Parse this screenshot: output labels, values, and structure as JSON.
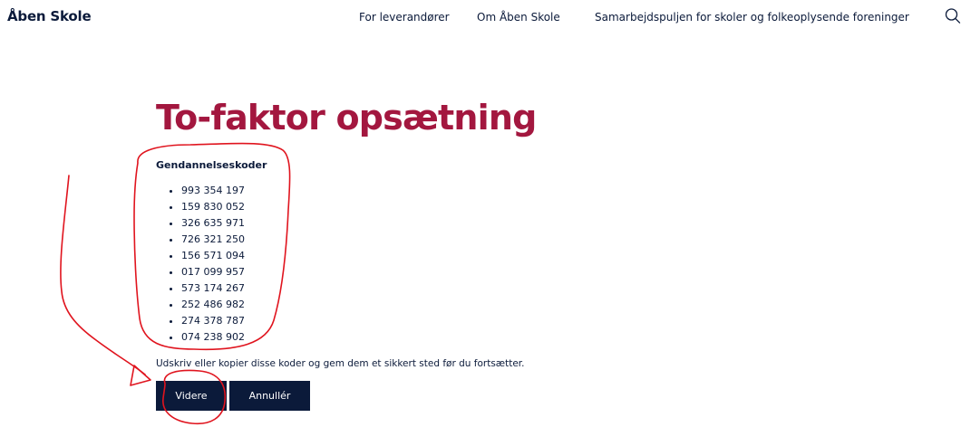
{
  "header": {
    "logo": "Åben Skole",
    "nav": [
      {
        "label": "For leverandører"
      },
      {
        "label": "Om Åben Skole"
      },
      {
        "label": "Samarbejdspuljen for skoler og folkeoplysende foreninger"
      }
    ],
    "search_icon": "search-icon"
  },
  "main": {
    "title": "To-faktor opsætning",
    "codes_heading": "Gendannelseskoder",
    "codes": [
      "993 354 197",
      "159 830 052",
      "326 635 971",
      "726 321 250",
      "156 571 094",
      "017 099 957",
      "573 174 267",
      "252 486 982",
      "274 378 787",
      "074 238 902"
    ],
    "instruction": "Udskriv eller kopier disse koder og gem dem et sikkert sted før du fortsætter.",
    "continue_label": "Videre",
    "cancel_label": "Annullér"
  },
  "colors": {
    "title": "#a3173f",
    "text": "#0b1a3a",
    "button_bg": "#0b1a3a",
    "button_text": "#ffffff",
    "annotation": "#e0141e"
  }
}
